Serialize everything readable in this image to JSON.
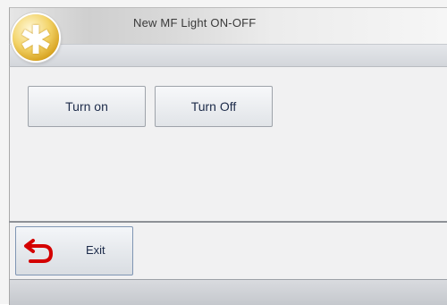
{
  "window": {
    "title": "New MF Light ON-OFF",
    "app_icon": "asterisk-icon",
    "app_icon_glyph": "✱"
  },
  "actions": {
    "turn_on_label": "Turn on",
    "turn_off_label": "Turn Off"
  },
  "footer": {
    "exit_label": "Exit",
    "exit_icon": "return-arrow-icon"
  },
  "colors": {
    "button_text": "#1d2b4a",
    "exit_arrow": "#d40000",
    "app_icon_gold": "#d8a422"
  }
}
